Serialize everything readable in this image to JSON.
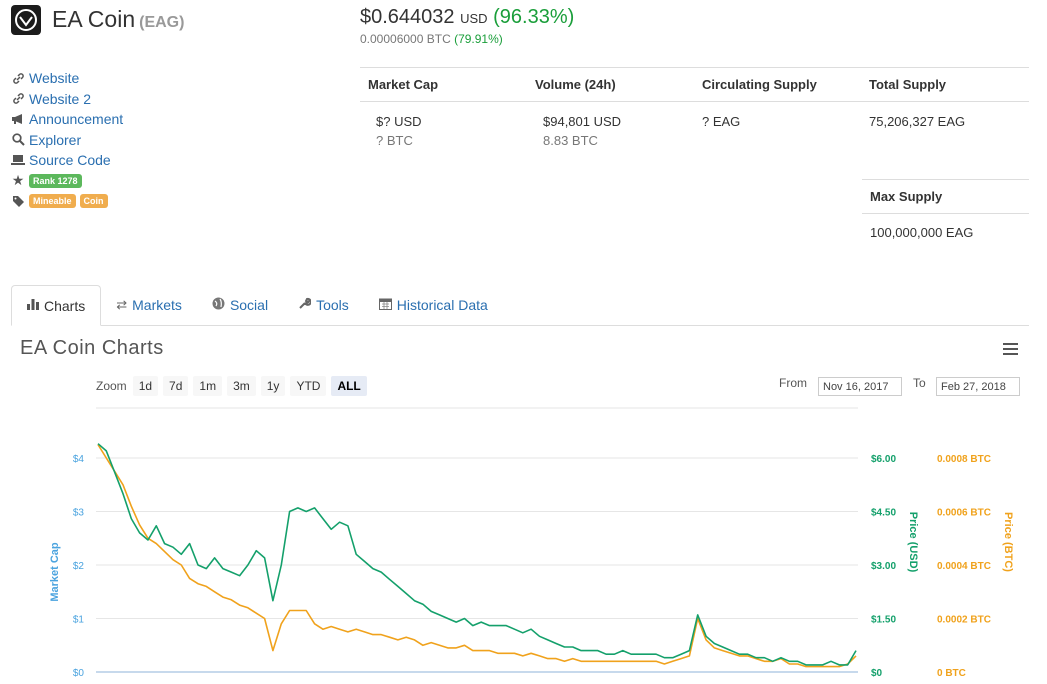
{
  "coin": {
    "name": "EA Coin",
    "symbol": "(EAG)"
  },
  "price": {
    "usd": "$0.644032",
    "usd_unit": "USD",
    "usd_change": "(96.33%)",
    "btc": "0.00006000 BTC",
    "btc_change": "(79.91%)"
  },
  "links": [
    {
      "icon": "link-icon",
      "label": "Website"
    },
    {
      "icon": "link-icon",
      "label": "Website 2"
    },
    {
      "icon": "megaphone-icon",
      "label": "Announcement"
    },
    {
      "icon": "search-icon",
      "label": "Explorer"
    },
    {
      "icon": "laptop-icon",
      "label": "Source Code"
    }
  ],
  "rank_badge": "Rank 1278",
  "tags": [
    "Mineable",
    "Coin"
  ],
  "stats": {
    "headers": [
      "Market Cap",
      "Volume (24h)",
      "Circulating Supply",
      "Total Supply"
    ],
    "market_cap_usd": "$? USD",
    "market_cap_btc": "? BTC",
    "volume_usd": "$94,801 USD",
    "volume_btc": "8.83 BTC",
    "circulating": "? EAG",
    "total": "75,206,327 EAG",
    "max_header": "Max Supply",
    "max": "100,000,000 EAG"
  },
  "tabs": [
    {
      "label": "Charts",
      "icon": "bar-chart-icon",
      "active": true
    },
    {
      "label": "Markets",
      "icon": "exchange-arrows-icon",
      "active": false
    },
    {
      "label": "Social",
      "icon": "globe-icon",
      "active": false
    },
    {
      "label": "Tools",
      "icon": "wrench-icon",
      "active": false
    },
    {
      "label": "Historical Data",
      "icon": "calendar-icon",
      "active": false
    }
  ],
  "charts_title": "EA Coin Charts",
  "zoom": {
    "label": "Zoom",
    "buttons": [
      "1d",
      "7d",
      "1m",
      "3m",
      "1y",
      "YTD",
      "ALL"
    ],
    "selected": "ALL",
    "from_label": "From",
    "from_value": "Nov 16, 2017",
    "to_label": "To",
    "to_value": "Feb 27, 2018"
  },
  "colors": {
    "market_cap": "#4aa3df",
    "price_usd": "#14a06b",
    "price_btc": "#f0a21c",
    "positive": "#1a9e3a",
    "link": "#2a6fb0"
  },
  "chart_data": {
    "type": "line",
    "x_range": [
      "Nov 16, 2017",
      "Feb 27, 2018"
    ],
    "axes": {
      "left": {
        "label": "Market Cap",
        "ticks": [
          "$0",
          "$1",
          "$2",
          "$3",
          "$4"
        ],
        "range": [
          0,
          4
        ]
      },
      "right_usd": {
        "label": "Price (USD)",
        "ticks": [
          "$0",
          "$1.50",
          "$3.00",
          "$4.50",
          "$6.00"
        ],
        "range": [
          0,
          6
        ]
      },
      "right_btc": {
        "label": "Price (BTC)",
        "ticks": [
          "0 BTC",
          "0.0002 BTC",
          "0.0004 BTC",
          "0.0006 BTC",
          "0.0008 BTC"
        ],
        "range": [
          0,
          0.0008
        ]
      }
    },
    "series": [
      {
        "axis": "right_usd",
        "values": [
          6.4,
          6.2,
          5.6,
          5.0,
          4.3,
          3.9,
          3.7,
          4.1,
          3.6,
          3.5,
          3.3,
          3.6,
          3.0,
          2.9,
          3.2,
          2.9,
          2.8,
          2.7,
          3.0,
          3.4,
          3.2,
          2.0,
          3.0,
          4.5,
          4.6,
          4.5,
          4.6,
          4.3,
          4.0,
          4.2,
          4.1,
          3.3,
          3.1,
          2.9,
          2.8,
          2.6,
          2.4,
          2.2,
          2.0,
          1.9,
          1.7,
          1.6,
          1.5,
          1.4,
          1.5,
          1.3,
          1.4,
          1.3,
          1.3,
          1.3,
          1.2,
          1.1,
          1.2,
          1.0,
          0.9,
          0.8,
          0.7,
          0.7,
          0.6,
          0.6,
          0.6,
          0.5,
          0.5,
          0.6,
          0.5,
          0.5,
          0.5,
          0.5,
          0.4,
          0.4,
          0.5,
          0.6,
          1.6,
          1.0,
          0.8,
          0.7,
          0.6,
          0.5,
          0.5,
          0.4,
          0.4,
          0.3,
          0.4,
          0.3,
          0.3,
          0.2,
          0.2,
          0.2,
          0.3,
          0.2,
          0.2,
          0.6
        ]
      },
      {
        "axis": "right_btc",
        "values": [
          0.00085,
          0.0008,
          0.00075,
          0.0007,
          0.00062,
          0.00055,
          0.0005,
          0.00048,
          0.00045,
          0.00042,
          0.0004,
          0.00035,
          0.00033,
          0.00032,
          0.0003,
          0.00028,
          0.00027,
          0.00025,
          0.00024,
          0.00022,
          0.0002,
          8e-05,
          0.00018,
          0.00023,
          0.00023,
          0.00023,
          0.00018,
          0.00016,
          0.00017,
          0.00016,
          0.00015,
          0.00016,
          0.00015,
          0.00014,
          0.00014,
          0.00013,
          0.00012,
          0.00013,
          0.00012,
          0.0001,
          0.00011,
          0.0001,
          9e-05,
          9e-05,
          0.0001,
          8e-05,
          8e-05,
          8e-05,
          7e-05,
          7e-05,
          7e-05,
          6e-05,
          7e-05,
          6e-05,
          5e-05,
          5e-05,
          4e-05,
          5e-05,
          4e-05,
          4e-05,
          4e-05,
          4e-05,
          4e-05,
          4e-05,
          4e-05,
          4e-05,
          4e-05,
          4e-05,
          3e-05,
          4e-05,
          5e-05,
          6e-05,
          0.0002,
          0.00012,
          9e-05,
          8e-05,
          7e-05,
          6e-05,
          6e-05,
          5e-05,
          4e-05,
          4e-05,
          5e-05,
          3e-05,
          3e-05,
          2e-05,
          2e-05,
          2e-05,
          2e-05,
          2e-05,
          3e-05,
          6e-05
        ]
      }
    ]
  }
}
